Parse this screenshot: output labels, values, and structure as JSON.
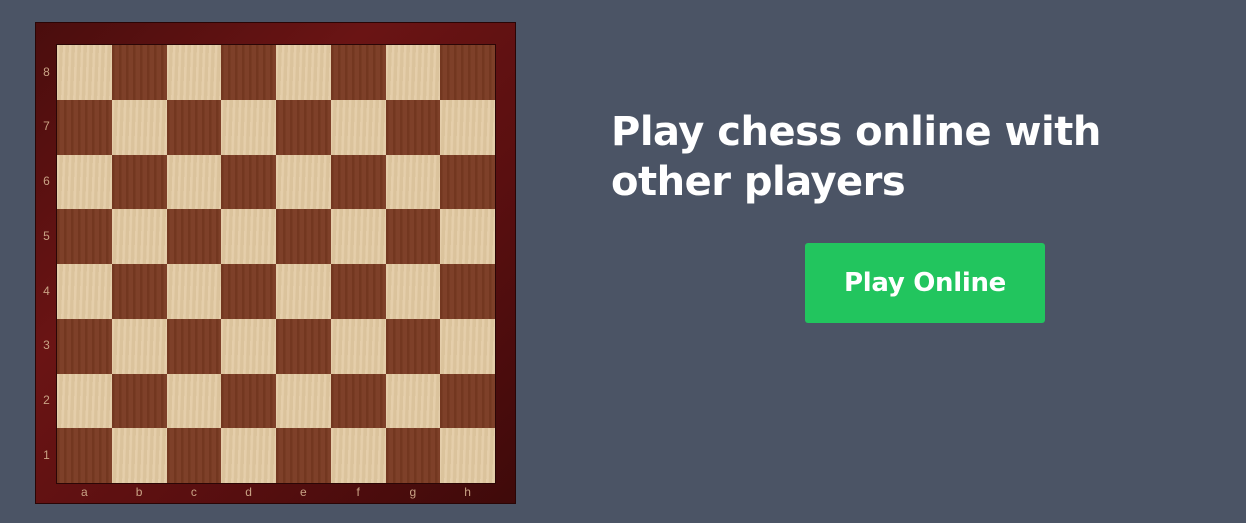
{
  "board": {
    "ranks": [
      "8",
      "7",
      "6",
      "5",
      "4",
      "3",
      "2",
      "1"
    ],
    "files": [
      "a",
      "b",
      "c",
      "d",
      "e",
      "f",
      "g",
      "h"
    ],
    "colors": {
      "light_square": "#e2c9a1",
      "dark_square": "#7a3a22",
      "frame": "#5a0f10",
      "coordinate_text": "#c9a385"
    }
  },
  "hero": {
    "headline": "Play chess online with other players",
    "play_button_label": "Play Online"
  },
  "colors": {
    "page_background": "#4b5465",
    "button_background": "#22c55e",
    "button_text": "#ffffff",
    "headline_text": "#ffffff"
  }
}
